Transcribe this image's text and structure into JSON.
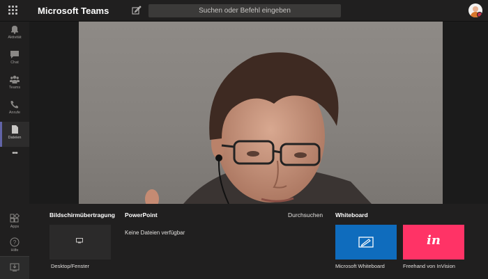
{
  "app": {
    "title": "Microsoft Teams"
  },
  "search": {
    "placeholder": "Suchen oder Befehl eingeben"
  },
  "rail": {
    "items": [
      {
        "label": "Aktivität",
        "icon": "bell-icon"
      },
      {
        "label": "Chat",
        "icon": "chat-icon"
      },
      {
        "label": "Teams",
        "icon": "teams-icon"
      },
      {
        "label": "Anrufe",
        "icon": "phone-icon"
      },
      {
        "label": "Dateien",
        "icon": "file-icon",
        "active": true
      },
      {
        "label": "•••",
        "icon": "more-icon"
      }
    ],
    "bottom": [
      {
        "label": "Apps",
        "icon": "apps-icon"
      },
      {
        "label": "Hilfe",
        "icon": "help-icon"
      }
    ]
  },
  "share_tray": {
    "screen_share": {
      "title": "Bildschirmübertragung",
      "option_label": "Desktop/Fenster"
    },
    "powerpoint": {
      "title": "PowerPoint",
      "empty_text": "Keine Dateien verfügbar",
      "browse_label": "Durchsuchen"
    },
    "whiteboard": {
      "title": "Whiteboard",
      "microsoft_label": "Microsoft Whiteboard",
      "invision_label": "Freehand von InVision",
      "invision_logo": "in"
    }
  },
  "colors": {
    "accent": "#6264a7",
    "whiteboard_tile": "#0f6cbd",
    "invision_tile": "#ff3366"
  }
}
